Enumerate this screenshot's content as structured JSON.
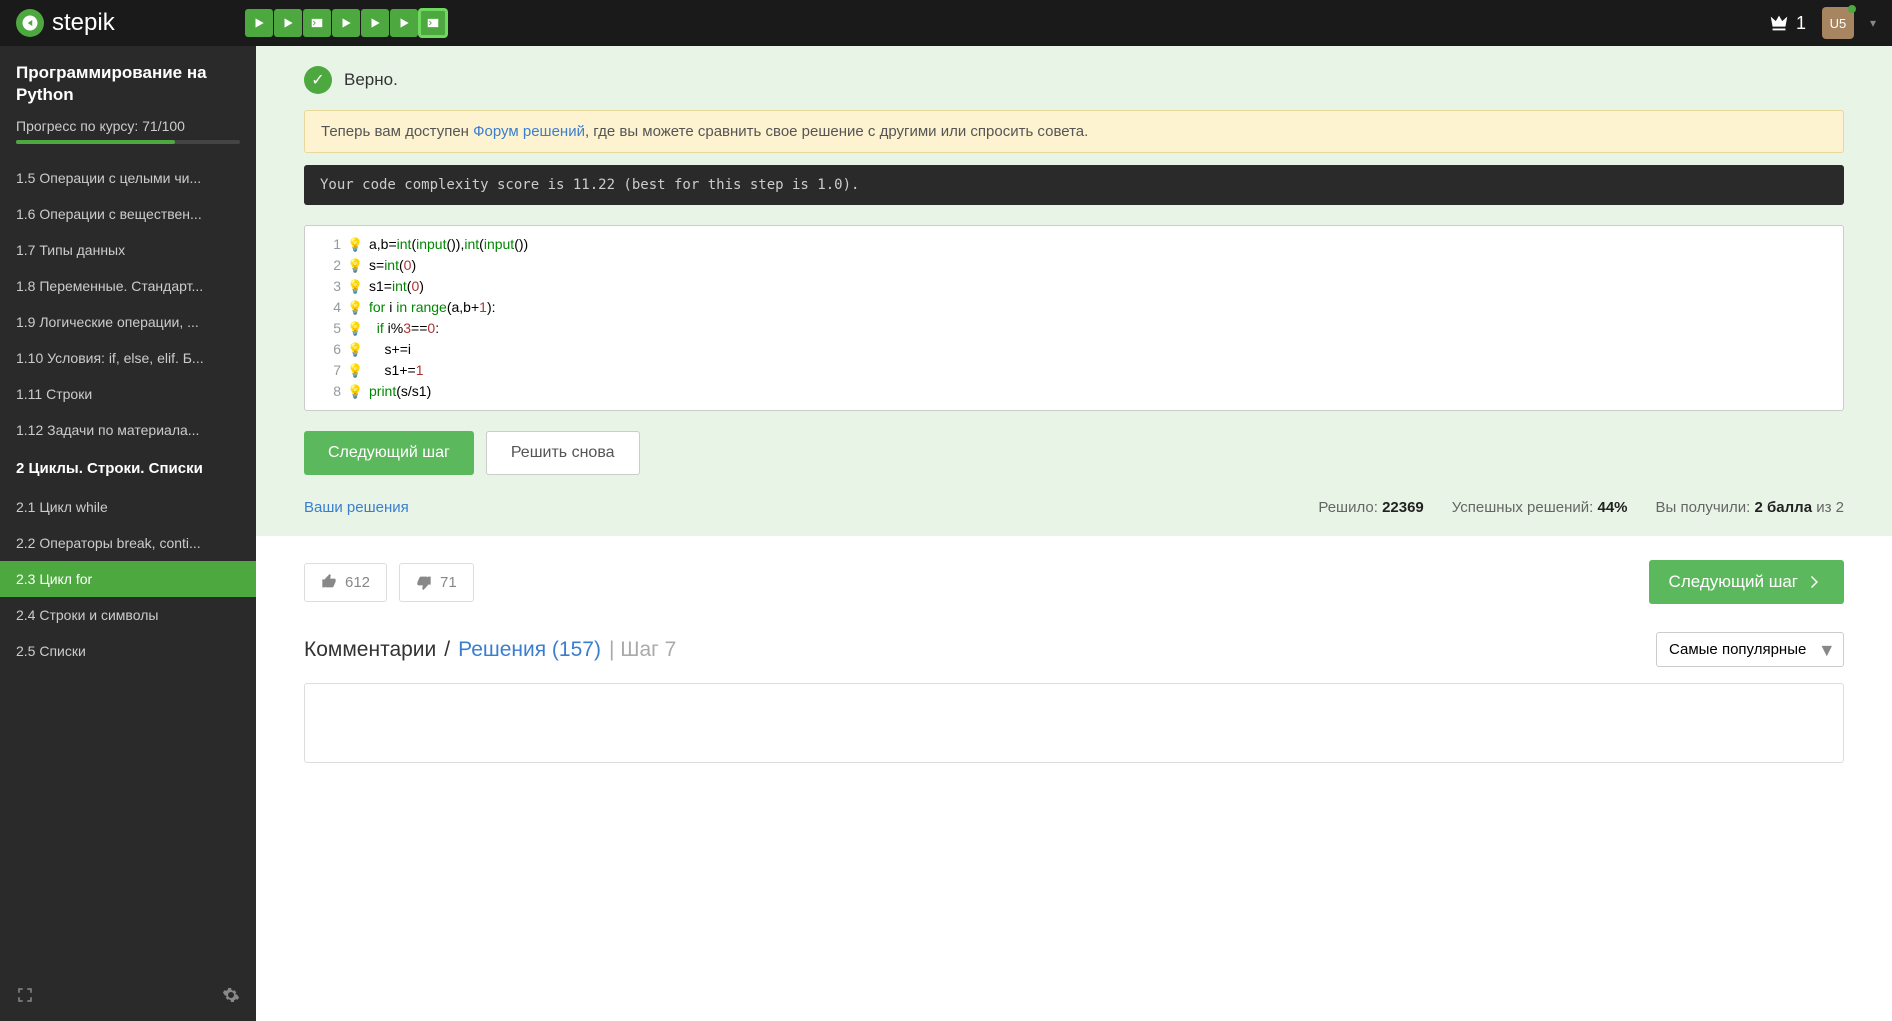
{
  "header": {
    "logo_text": "stepik",
    "crown_count": "1",
    "avatar_text": "U5"
  },
  "step_tabs": [
    {
      "type": "play"
    },
    {
      "type": "play"
    },
    {
      "type": "code"
    },
    {
      "type": "play"
    },
    {
      "type": "play"
    },
    {
      "type": "play"
    },
    {
      "type": "code",
      "active": true
    }
  ],
  "sidebar": {
    "course_title": "Программирование на Python",
    "progress_label": "Прогресс по курсу:  71/100",
    "progress_percent": 71,
    "items": [
      {
        "label": "1.5  Операции с целыми чи..."
      },
      {
        "label": "1.6  Операции с веществен..."
      },
      {
        "label": "1.7  Типы данных"
      },
      {
        "label": "1.8  Переменные. Стандарт..."
      },
      {
        "label": "1.9  Логические операции, ..."
      },
      {
        "label": "1.10  Условия: if, else, elif. Б..."
      },
      {
        "label": "1.11  Строки"
      },
      {
        "label": "1.12  Задачи по материала..."
      }
    ],
    "section2_title": "2  Циклы. Строки. Списки",
    "items2": [
      {
        "label": "2.1  Цикл while"
      },
      {
        "label": "2.2  Операторы break, conti..."
      },
      {
        "label": "2.3  Цикл for",
        "active": true
      },
      {
        "label": "2.4  Строки и символы"
      },
      {
        "label": "2.5  Списки"
      }
    ]
  },
  "result": {
    "status_text": "Верно.",
    "forum_prefix": "Теперь вам доступен ",
    "forum_link": "Форум решений",
    "forum_suffix": ", где вы можете сравнить свое решение с другими или спросить совета.",
    "complexity_text": "Your code complexity score is 11.22 (best for this step is 1.0).",
    "code_lines": [
      "a,b=int(input()),int(input())",
      "s=int(0)",
      "s1=int(0)",
      "for i in range(a,b+1):",
      "  if i%3==0:",
      "    s+=i",
      "    s1+=1",
      "print(s/s1)"
    ],
    "btn_next": "Следующий шаг",
    "btn_retry": "Решить снова",
    "your_solutions": "Ваши решения",
    "solved_label": "Решило: ",
    "solved_count": "22369",
    "success_label": "Успешных решений: ",
    "success_pct": "44%",
    "score_label": "Вы получили: ",
    "score_value": "2 балла",
    "score_suffix": " из 2"
  },
  "votes": {
    "up": "612",
    "down": "71"
  },
  "bottom": {
    "next_step": "Следующий шаг",
    "comments_tab": "Комментарии",
    "solutions_tab": "Решения (157)",
    "step_label": "| Шаг 7",
    "sort_selected": "Самые популярные"
  }
}
